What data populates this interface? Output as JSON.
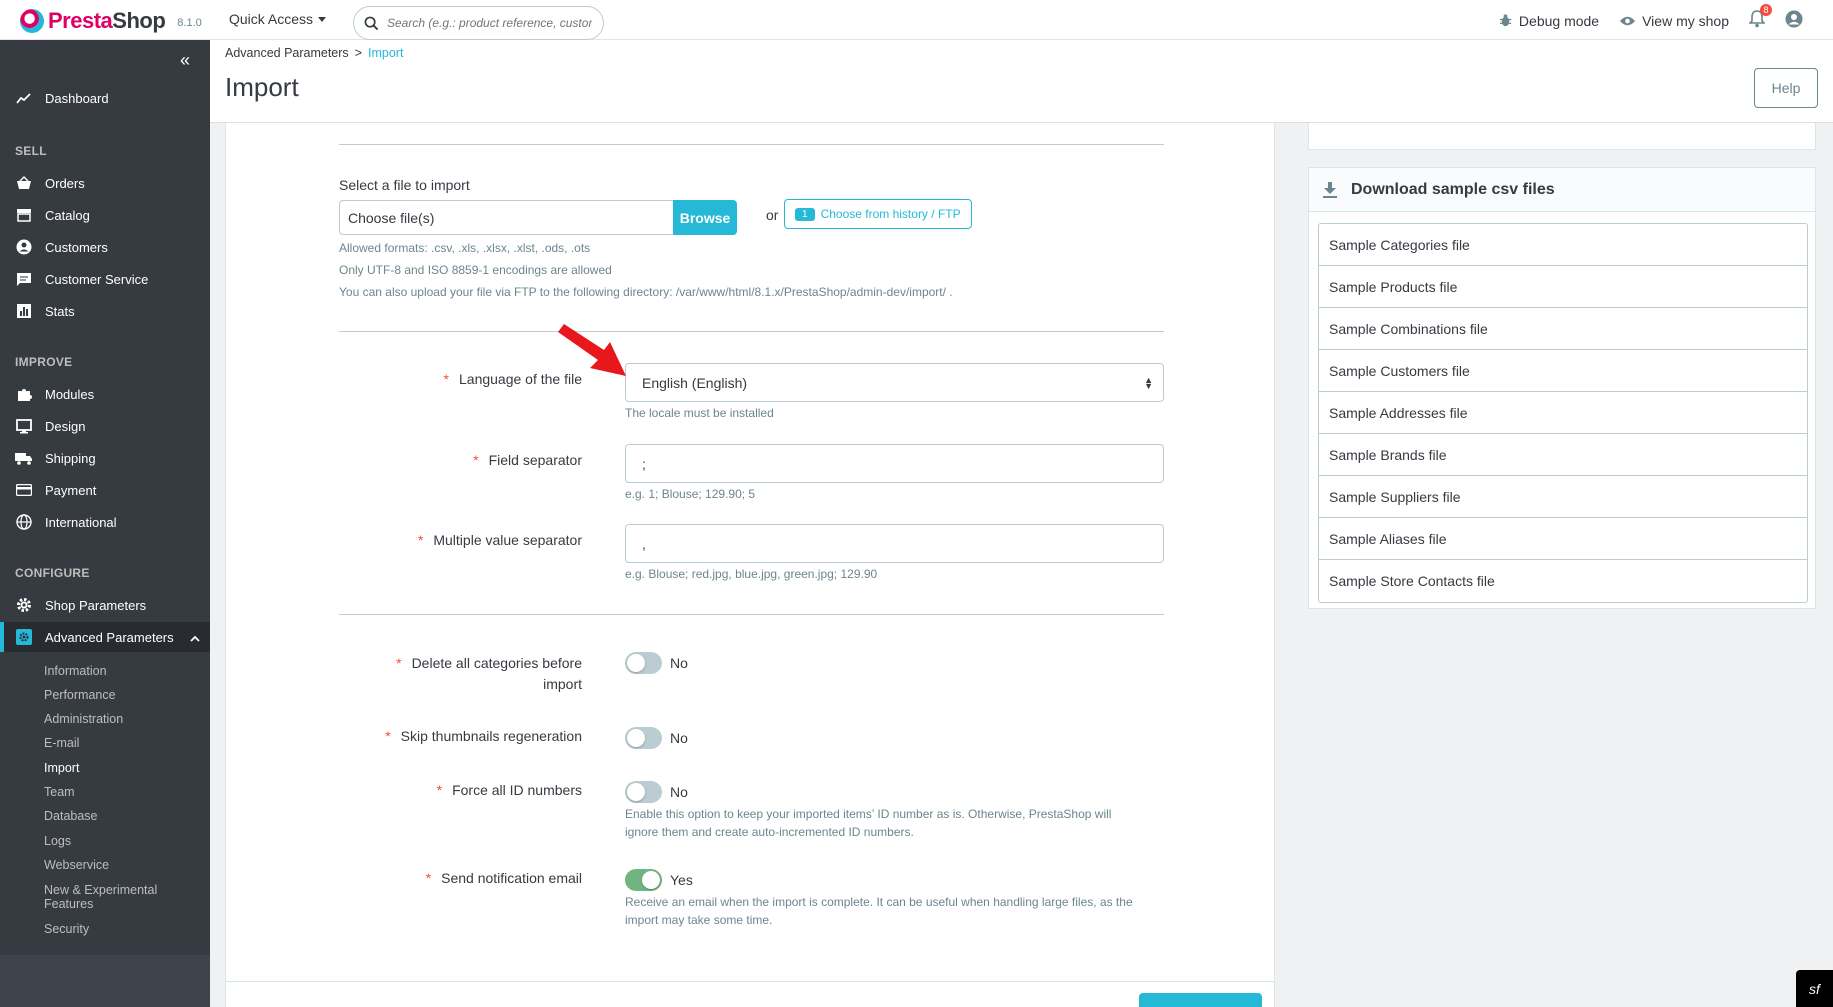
{
  "header": {
    "brand_pre": "Presta",
    "brand_post": "Shop",
    "version": "8.1.0",
    "quick_access": "Quick Access",
    "search_placeholder": "Search (e.g.: product reference, custon",
    "debug_mode": "Debug mode",
    "view_shop": "View my shop",
    "notification_count": "8"
  },
  "sidebar": {
    "dashboard": "Dashboard",
    "section_sell": "SELL",
    "orders": "Orders",
    "catalog": "Catalog",
    "customers": "Customers",
    "customer_service": "Customer Service",
    "stats": "Stats",
    "section_improve": "IMPROVE",
    "modules": "Modules",
    "design": "Design",
    "shipping": "Shipping",
    "payment": "Payment",
    "international": "International",
    "section_configure": "CONFIGURE",
    "shop_parameters": "Shop Parameters",
    "advanced_parameters": "Advanced Parameters",
    "sub": {
      "information": "Information",
      "performance": "Performance",
      "administration": "Administration",
      "email": "E-mail",
      "import": "Import",
      "team": "Team",
      "database": "Database",
      "logs": "Logs",
      "webservice": "Webservice",
      "new_experimental_1": "New & Experimental",
      "new_experimental_2": "Features",
      "security": "Security"
    }
  },
  "page": {
    "breadcrumb_parent": "Advanced Parameters",
    "breadcrumb_sep": ">",
    "breadcrumb_current": "Import",
    "title": "Import",
    "help_label": "Help"
  },
  "form": {
    "select_file_label": "Select a file to import",
    "file_placeholder": "Choose file(s)",
    "browse_label": "Browse",
    "or_text": "or",
    "history_count": "1",
    "history_label": "Choose from history / FTP",
    "help_formats": "Allowed formats: .csv, .xls, .xlsx, .xlst, .ods, .ots",
    "help_encodings": "Only UTF-8 and ISO 8859-1 encodings are allowed",
    "help_ftp": "You can also upload your file via FTP to the following directory: /var/www/html/8.1.x/PrestaShop/admin-dev/import/ .",
    "required_mark": "*",
    "language_label": "Language of the file",
    "language_value": "English (English)",
    "language_help": "The locale must be installed",
    "field_sep_label": "Field separator",
    "field_sep_value": ";",
    "field_sep_help": "e.g. 1; Blouse; 129.90; 5",
    "multi_sep_label": "Multiple value separator",
    "multi_sep_value": ",",
    "multi_sep_help": "e.g. Blouse; red.jpg, blue.jpg, green.jpg; 129.90",
    "delete_cats_label_1": "Delete all categories before",
    "delete_cats_label_2": "import",
    "delete_cats_value": "No",
    "skip_thumbs_label": "Skip thumbnails regeneration",
    "skip_thumbs_value": "No",
    "force_ids_label": "Force all ID numbers",
    "force_ids_value": "No",
    "force_ids_help_1": "Enable this option to keep your imported items’ ID number as is. Otherwise, PrestaShop will",
    "force_ids_help_2": "ignore them and create auto-incremented ID numbers.",
    "send_email_label": "Send notification email",
    "send_email_value": "Yes",
    "send_email_help_1": "Receive an email when the import is complete. It can be useful when handling large files, as the",
    "send_email_help_2": "import may take some time.",
    "toggles": {
      "delete_categories": false,
      "skip_thumbnails": false,
      "force_ids": false,
      "send_email": true
    }
  },
  "samples": {
    "title": "Download sample csv files",
    "items": [
      "Sample Categories file",
      "Sample Products file",
      "Sample Combinations file",
      "Sample Customers file",
      "Sample Addresses file",
      "Sample Brands file",
      "Sample Suppliers file",
      "Sample Aliases file",
      "Sample Store Contacts file"
    ]
  },
  "colors": {
    "accent": "#25b9d7",
    "sidebar_bg": "#363a41",
    "toggle_on": "#70b580",
    "required": "#f54c3e",
    "annotation_arrow": "#e8171c"
  },
  "icons": {
    "logo": "prestashop-logo-icon",
    "search": "search-icon",
    "debug": "bug-icon",
    "view": "eye-icon",
    "notifications": "bell-icon",
    "account": "user-circle-icon",
    "download": "download-icon"
  }
}
